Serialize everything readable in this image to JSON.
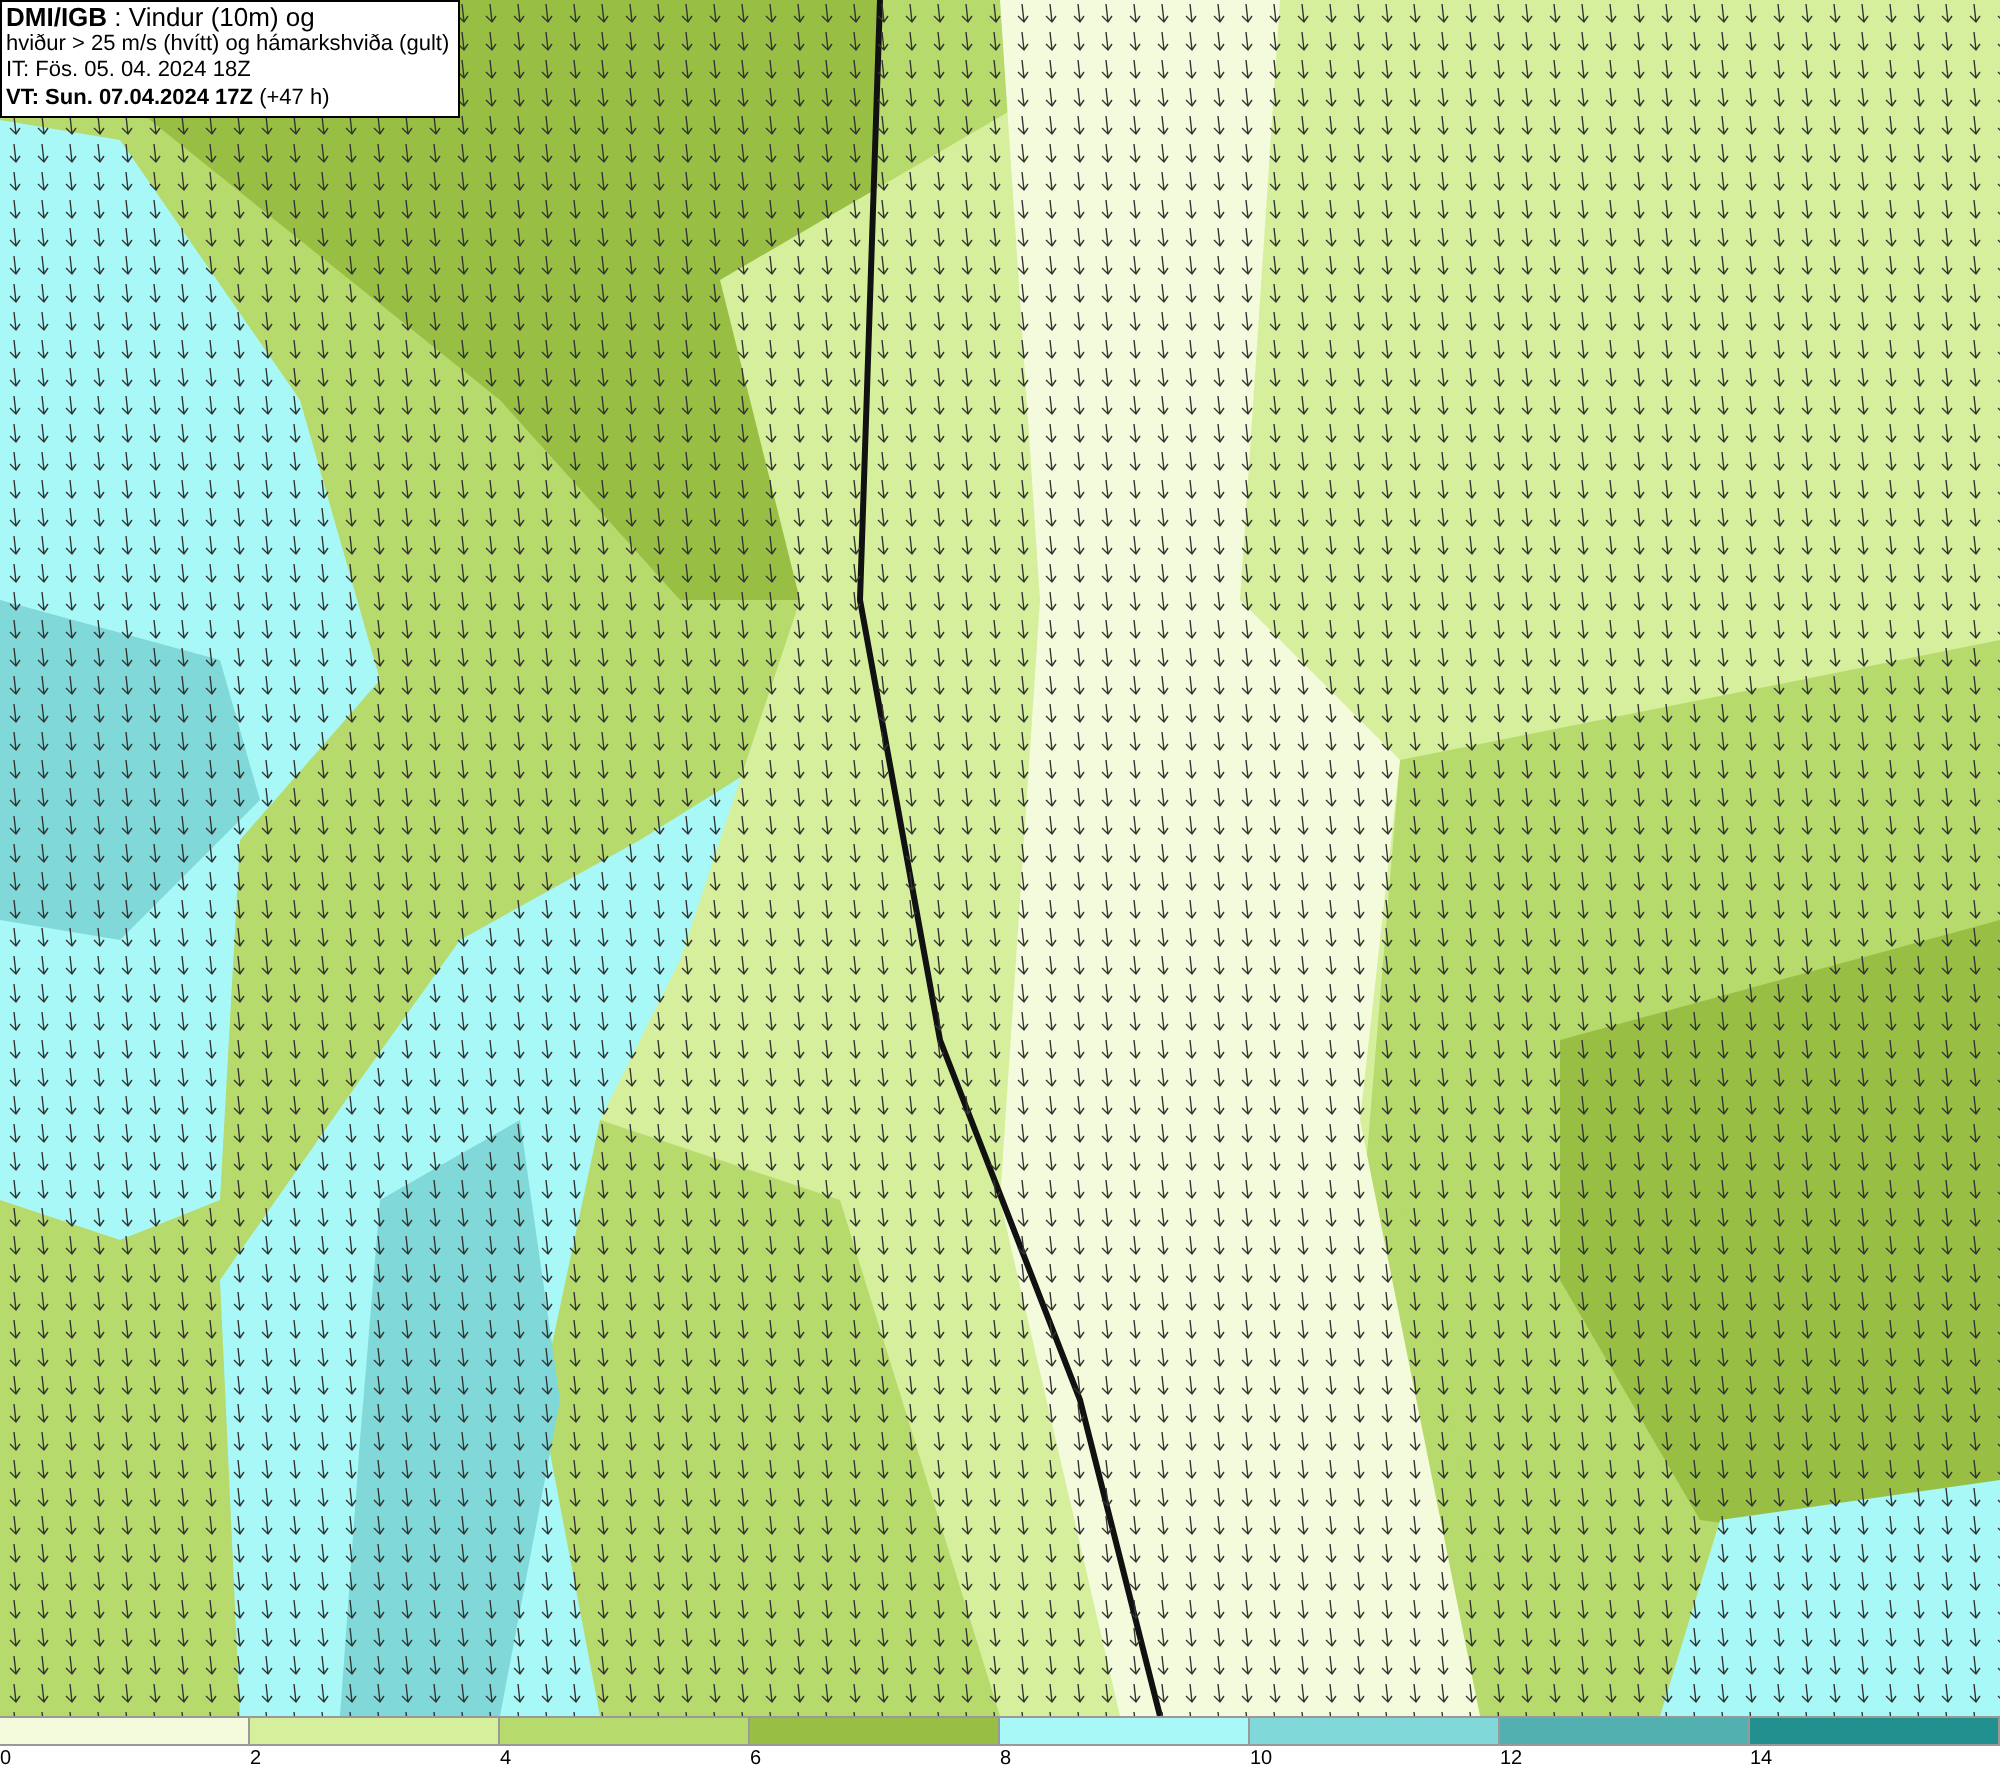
{
  "title_box": {
    "lines": [
      "**DMI/IGB** : Vindur (10m) og",
      "hviður > 25 m/s (hvítt) og hámarkshviða (gult)",
      "IT: Fös. 05. 04. 2024 18Z",
      "**VT: Sun. 07.04.2024 17Z** (+47 h)"
    ]
  },
  "legend": {
    "bins": [
      {
        "color": "#f4fbdc",
        "label": "0"
      },
      {
        "color": "#d6ef9c",
        "label": "2"
      },
      {
        "color": "#b6da6c",
        "label": "4"
      },
      {
        "color": "#98bf44",
        "label": "6"
      },
      {
        "color": "#a8f8f8",
        "label": "8"
      },
      {
        "color": "#80d8d8",
        "label": "10"
      },
      {
        "color": "#52b0b0",
        "label": "12"
      },
      {
        "color": "#22908e",
        "label": "14"
      }
    ]
  }
}
